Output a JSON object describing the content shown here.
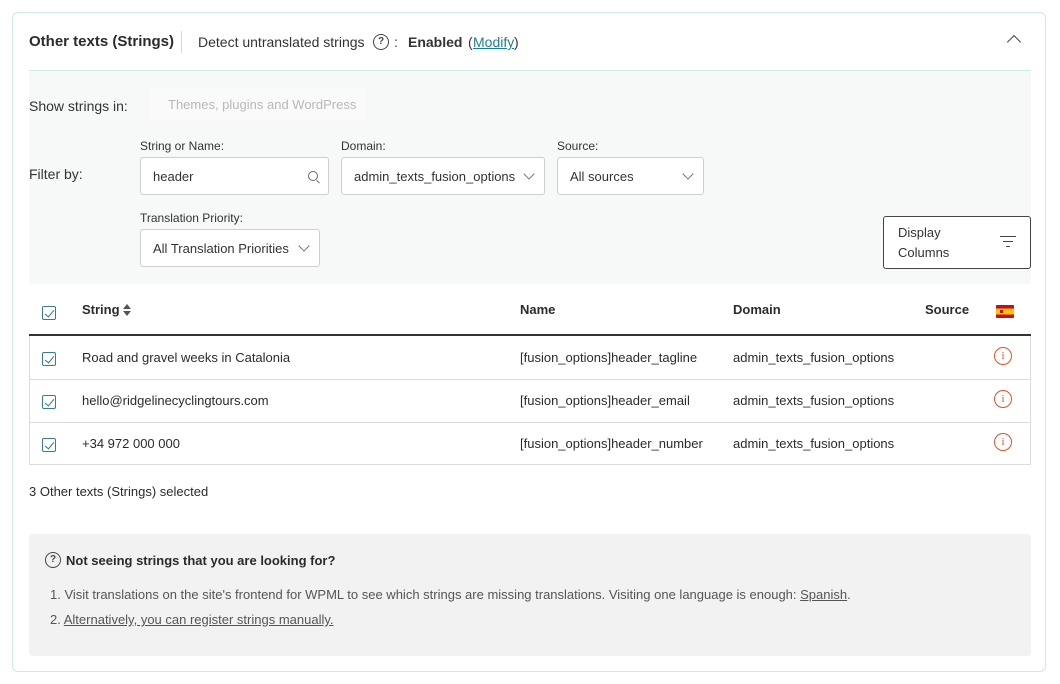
{
  "header": {
    "title": "Other texts (Strings)",
    "detect_label": "Detect untranslated strings",
    "help_glyph": "?",
    "colon": ":",
    "status": "Enabled",
    "paren_open": "(",
    "modify_link": "Modify",
    "paren_close": ")",
    "collapse_icon": "chevron-up-icon"
  },
  "filters": {
    "show_strings_label": "Show strings in:",
    "show_strings_placeholder": "Themes, plugins and WordPress",
    "filter_by_label": "Filter by:",
    "string_or_name": {
      "label": "String or Name:",
      "value": "header"
    },
    "domain": {
      "label": "Domain:",
      "value": "admin_texts_fusion_options"
    },
    "source": {
      "label": "Source:",
      "value": "All sources"
    },
    "translation_priority": {
      "label": "Translation Priority:",
      "value": "All Translation Priorities"
    },
    "display_columns": {
      "line1": "Display",
      "line2": "Columns"
    }
  },
  "table": {
    "headers": {
      "string": "String",
      "name": "Name",
      "domain": "Domain",
      "source": "Source",
      "language_flag": "spanish-flag-icon"
    },
    "rows": [
      {
        "checked": true,
        "string": "Road and gravel weeks in Catalonia",
        "name": "[fusion_options]header_tagline",
        "domain": "admin_texts_fusion_options",
        "source": "",
        "status_icon": "info-icon"
      },
      {
        "checked": true,
        "string": "hello@ridgelinecyclingtours.com",
        "name": "[fusion_options]header_email",
        "domain": "admin_texts_fusion_options",
        "source": "",
        "status_icon": "info-icon"
      },
      {
        "checked": true,
        "string": "+34 972 000 000",
        "name": "[fusion_options]header_number",
        "domain": "admin_texts_fusion_options",
        "source": "",
        "status_icon": "info-icon"
      }
    ]
  },
  "selection_text": "3 Other texts (Strings) selected",
  "notice": {
    "title": "Not seeing strings that you are looking for?",
    "item1_text": "1. Visit translations on the site's frontend for WPML to see which strings are missing translations. Visiting one language is enough: ",
    "item1_link": "Spanish",
    "item1_end": ".",
    "item2_prefix": "2. ",
    "item2_link": "Alternatively, you can register strings manually."
  },
  "colors": {
    "accent": "#1e7f90",
    "warning": "#d9542b",
    "checkbox": "#2f7683"
  }
}
